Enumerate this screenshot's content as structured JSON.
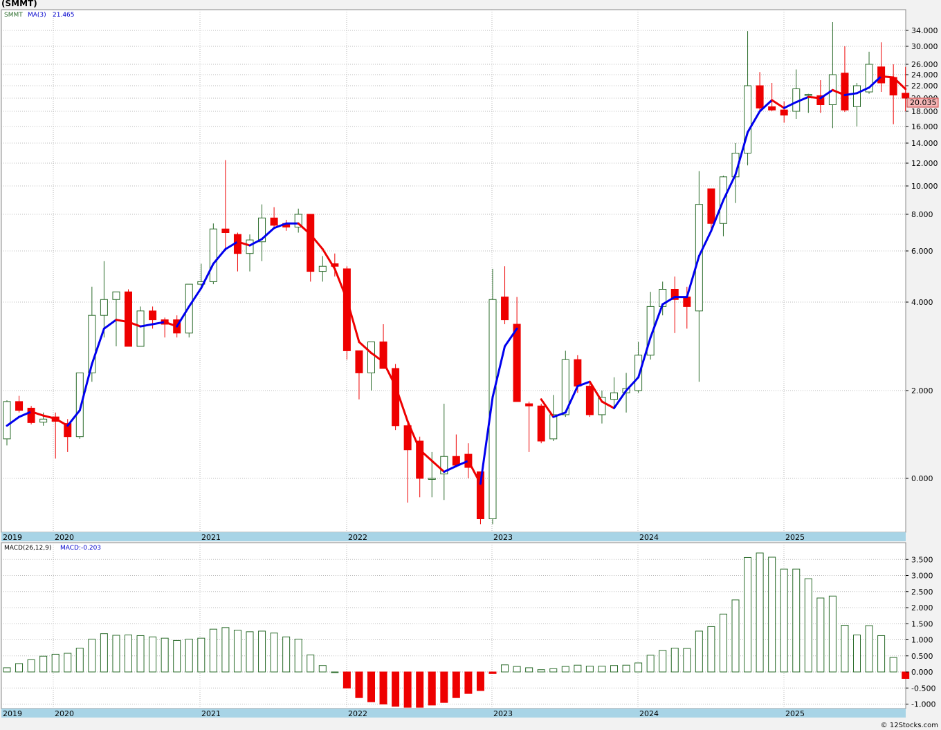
{
  "title": "(SMMT)",
  "credit": "© 12Stocks.com",
  "price_legend": {
    "symbol": "SMMT",
    "ma_label": "MA(3)",
    "ma_value": "21.465"
  },
  "macd_legend": {
    "label": "MACD(26,12,9)",
    "value_label": "MACD:-0.203"
  },
  "last_price_label": "20.035",
  "colors": {
    "up": "#2a6b2a",
    "down": "#ee0000",
    "ma_up": "#0000ee",
    "ma_down": "#ee0000",
    "axis_band": "#a8d4e6",
    "grid": "#bbbbbb"
  },
  "chart_data": [
    {
      "type": "candlestick",
      "title": "SMMT",
      "grid": true,
      "y_tick_labels": [
        "0.000",
        "2.000",
        "4.000",
        "6.000",
        "8.000",
        "10.000",
        "12.000",
        "14.000",
        "16.000",
        "18.000",
        "20.000",
        "22.000",
        "24.000",
        "26.000",
        "30.000",
        "34.000"
      ],
      "x_year_labels": [
        "2019",
        "2020",
        "2021",
        "2022",
        "2023",
        "2024",
        "2025"
      ],
      "candles": [
        {
          "o": 0.9,
          "h": 1.78,
          "l": 0.75,
          "c": 1.75
        },
        {
          "o": 1.75,
          "h": 1.88,
          "l": 1.5,
          "c": 1.55
        },
        {
          "o": 1.6,
          "h": 1.65,
          "l": 1.23,
          "c": 1.27
        },
        {
          "o": 1.28,
          "h": 1.5,
          "l": 1.2,
          "c": 1.35
        },
        {
          "o": 1.4,
          "h": 1.5,
          "l": 0.45,
          "c": 1.3
        },
        {
          "o": 1.25,
          "h": 1.35,
          "l": 0.6,
          "c": 0.95
        },
        {
          "o": 0.95,
          "h": 2.3,
          "l": 0.9,
          "c": 2.4
        },
        {
          "o": 2.4,
          "h": 4.6,
          "l": 2.2,
          "c": 3.7
        },
        {
          "o": 3.7,
          "h": 5.6,
          "l": 3.2,
          "c": 4.1
        },
        {
          "o": 4.1,
          "h": 4.3,
          "l": 3.0,
          "c": 4.4
        },
        {
          "o": 4.4,
          "h": 4.5,
          "l": 3.0,
          "c": 3.0
        },
        {
          "o": 3.0,
          "h": 3.9,
          "l": 3.0,
          "c": 3.8
        },
        {
          "o": 3.8,
          "h": 3.9,
          "l": 3.4,
          "c": 3.6
        },
        {
          "o": 3.6,
          "h": 3.65,
          "l": 3.2,
          "c": 3.5
        },
        {
          "o": 3.6,
          "h": 3.7,
          "l": 3.2,
          "c": 3.3
        },
        {
          "o": 3.3,
          "h": 4.3,
          "l": 3.2,
          "c": 4.7
        },
        {
          "o": 4.7,
          "h": 5.5,
          "l": 4.5,
          "c": 4.8
        },
        {
          "o": 4.8,
          "h": 7.5,
          "l": 4.7,
          "c": 7.2
        },
        {
          "o": 7.2,
          "h": 12.3,
          "l": 6.0,
          "c": 7.0
        },
        {
          "o": 6.9,
          "h": 7.0,
          "l": 5.2,
          "c": 5.9
        },
        {
          "o": 5.9,
          "h": 6.9,
          "l": 5.2,
          "c": 6.6
        },
        {
          "o": 6.5,
          "h": 8.7,
          "l": 5.6,
          "c": 7.8
        },
        {
          "o": 7.8,
          "h": 8.5,
          "l": 7.3,
          "c": 7.4
        },
        {
          "o": 7.5,
          "h": 7.7,
          "l": 7.1,
          "c": 7.3
        },
        {
          "o": 7.3,
          "h": 8.4,
          "l": 7.0,
          "c": 8.0
        },
        {
          "o": 8.0,
          "h": 8.0,
          "l": 4.8,
          "c": 5.2
        },
        {
          "o": 5.2,
          "h": 5.8,
          "l": 4.8,
          "c": 5.4
        },
        {
          "o": 5.5,
          "h": 5.9,
          "l": 5.0,
          "c": 5.4
        },
        {
          "o": 5.3,
          "h": 5.4,
          "l": 2.7,
          "c": 2.9
        },
        {
          "o": 2.9,
          "h": 2.9,
          "l": 1.8,
          "c": 2.4
        },
        {
          "o": 2.4,
          "h": 3.0,
          "l": 2.0,
          "c": 3.1
        },
        {
          "o": 3.1,
          "h": 3.5,
          "l": 2.5,
          "c": 2.5
        },
        {
          "o": 2.5,
          "h": 2.6,
          "l": 1.1,
          "c": 1.2
        },
        {
          "o": 1.2,
          "h": 1.3,
          "l": -0.45,
          "c": 0.65
        },
        {
          "o": 0.85,
          "h": 0.95,
          "l": -0.35,
          "c": 0.0
        },
        {
          "o": 0.0,
          "h": 0.6,
          "l": -0.35,
          "c": 0.0
        },
        {
          "o": 0.1,
          "h": 1.7,
          "l": -0.4,
          "c": 0.5
        },
        {
          "o": 0.5,
          "h": 1.0,
          "l": 0.25,
          "c": 0.3
        },
        {
          "o": 0.55,
          "h": 0.8,
          "l": 0.0,
          "c": 0.25
        },
        {
          "o": 0.15,
          "h": 0.15,
          "l": -0.85,
          "c": -0.75
        },
        {
          "o": -0.75,
          "h": 5.3,
          "l": -0.85,
          "c": 4.1
        },
        {
          "o": 4.2,
          "h": 5.4,
          "l": 3.5,
          "c": 3.6
        },
        {
          "o": 3.5,
          "h": 4.2,
          "l": 1.9,
          "c": 1.75
        },
        {
          "o": 1.7,
          "h": 1.75,
          "l": 0.6,
          "c": 1.65
        },
        {
          "o": 1.65,
          "h": 1.7,
          "l": 0.8,
          "c": 0.85
        },
        {
          "o": 0.9,
          "h": 1.9,
          "l": 0.85,
          "c": 1.45
        },
        {
          "o": 1.45,
          "h": 2.9,
          "l": 1.4,
          "c": 2.7
        },
        {
          "o": 2.7,
          "h": 2.8,
          "l": 1.95,
          "c": 2.1
        },
        {
          "o": 2.1,
          "h": 2.2,
          "l": 1.4,
          "c": 1.45
        },
        {
          "o": 1.45,
          "h": 2.0,
          "l": 1.25,
          "c": 1.85
        },
        {
          "o": 1.8,
          "h": 2.3,
          "l": 1.6,
          "c": 1.95
        },
        {
          "o": 1.95,
          "h": 2.4,
          "l": 1.5,
          "c": 2.05
        },
        {
          "o": 2.0,
          "h": 3.1,
          "l": 1.95,
          "c": 2.8
        },
        {
          "o": 2.8,
          "h": 4.4,
          "l": 2.7,
          "c": 3.9
        },
        {
          "o": 3.9,
          "h": 4.8,
          "l": 3.7,
          "c": 4.5
        },
        {
          "o": 4.5,
          "h": 5.0,
          "l": 3.3,
          "c": 4.1
        },
        {
          "o": 4.2,
          "h": 4.6,
          "l": 3.4,
          "c": 3.9
        },
        {
          "o": 3.8,
          "h": 11.3,
          "l": 2.2,
          "c": 8.7
        },
        {
          "o": 9.8,
          "h": 9.8,
          "l": 7.2,
          "c": 7.5
        },
        {
          "o": 7.5,
          "h": 10.9,
          "l": 6.8,
          "c": 10.8
        },
        {
          "o": 10.8,
          "h": 14.0,
          "l": 8.8,
          "c": 13.0
        },
        {
          "o": 13.0,
          "h": 33.8,
          "l": 11.8,
          "c": 22.0
        },
        {
          "o": 22.0,
          "h": 24.5,
          "l": 18.2,
          "c": 18.5
        },
        {
          "o": 18.7,
          "h": 22.5,
          "l": 18.0,
          "c": 18.2
        },
        {
          "o": 18.2,
          "h": 19.5,
          "l": 16.5,
          "c": 17.5
        },
        {
          "o": 18.0,
          "h": 25.0,
          "l": 17.0,
          "c": 21.5
        },
        {
          "o": 20.5,
          "h": 20.7,
          "l": 17.8,
          "c": 20.6
        },
        {
          "o": 20.4,
          "h": 23.0,
          "l": 17.8,
          "c": 19.0
        },
        {
          "o": 19.0,
          "h": 37.0,
          "l": 15.8,
          "c": 24.0
        },
        {
          "o": 24.3,
          "h": 30.0,
          "l": 17.9,
          "c": 18.2
        },
        {
          "o": 18.7,
          "h": 22.5,
          "l": 16.0,
          "c": 22.0
        },
        {
          "o": 21.0,
          "h": 28.8,
          "l": 20.7,
          "c": 26.0
        },
        {
          "o": 25.5,
          "h": 31.0,
          "l": 21.0,
          "c": 22.5
        },
        {
          "o": 23.5,
          "h": 26.0,
          "l": 16.3,
          "c": 20.5
        },
        {
          "o": 20.8,
          "h": 25.5,
          "l": 18.0,
          "c": 20.0
        }
      ],
      "ma3": [
        1.2,
        1.4,
        1.52,
        1.43,
        1.36,
        1.2,
        1.55,
        2.6,
        3.4,
        3.6,
        3.55,
        3.45,
        3.5,
        3.55,
        3.45,
        3.9,
        4.55,
        5.5,
        6.1,
        6.5,
        6.3,
        6.65,
        7.25,
        7.5,
        7.5,
        6.9,
        6.1,
        5.3,
        4.1,
        3.1,
        2.85,
        2.65,
        2.1,
        1.3,
        0.65,
        0.4,
        0.15,
        0.28,
        0.4,
        -0.1,
        1.85,
        3.0,
        3.4,
        null,
        1.8,
        1.4,
        1.5,
        2.1,
        2.2,
        1.75,
        1.6,
        2.0,
        2.3,
        3.2,
        3.95,
        4.2,
        4.2,
        5.8,
        7.1,
        9.0,
        11.0,
        15.3,
        18.0,
        19.7,
        18.5,
        19.4,
        20.2,
        20.0,
        21.3,
        20.5,
        20.8,
        21.7,
        23.7,
        23.5,
        21.465
      ],
      "ma3_color_down_months_from_index": [
        4,
        11,
        13,
        24,
        31,
        41,
        44,
        47,
        61,
        64,
        71
      ]
    },
    {
      "type": "bar",
      "title": "MACD(26,12,9)",
      "y_tick_labels": [
        "-1.000",
        "-0.500",
        "0.000",
        "0.500",
        "1.000",
        "1.500",
        "2.000",
        "2.500",
        "3.000",
        "3.500"
      ],
      "x_year_labels": [
        "2019",
        "2020",
        "2021",
        "2022",
        "2023",
        "2024",
        "2025"
      ],
      "values": [
        0.13,
        0.26,
        0.38,
        0.49,
        0.55,
        0.58,
        0.74,
        1.02,
        1.19,
        1.14,
        1.15,
        1.13,
        1.09,
        1.05,
        0.98,
        1.02,
        1.05,
        1.33,
        1.38,
        1.3,
        1.25,
        1.27,
        1.21,
        1.09,
        1.02,
        0.53,
        0.2,
        0.0,
        -0.5,
        -0.8,
        -0.93,
        -1.0,
        -1.07,
        -1.1,
        -1.1,
        -1.03,
        -0.95,
        -0.8,
        -0.67,
        -0.58,
        -0.05,
        0.22,
        0.17,
        0.13,
        0.07,
        0.1,
        0.17,
        0.21,
        0.18,
        0.18,
        0.2,
        0.21,
        0.28,
        0.52,
        0.67,
        0.74,
        0.73,
        1.27,
        1.41,
        1.8,
        2.24,
        3.56,
        3.7,
        3.57,
        3.2,
        3.2,
        2.9,
        2.3,
        2.36,
        1.45,
        1.15,
        1.44,
        1.13,
        0.45,
        -0.203
      ]
    }
  ]
}
